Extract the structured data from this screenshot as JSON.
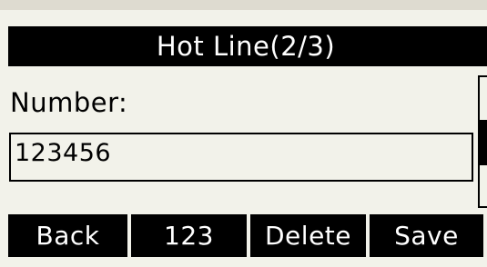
{
  "title": "Hot Line(2/3)",
  "form": {
    "number_label": "Number:",
    "number_value": "123456"
  },
  "softkeys": {
    "back": "Back",
    "mode": "123",
    "delete": "Delete",
    "save": "Save"
  },
  "colors": {
    "background": "#f2f2ea",
    "foreground": "#000000",
    "inverse_text": "#ffffff"
  }
}
